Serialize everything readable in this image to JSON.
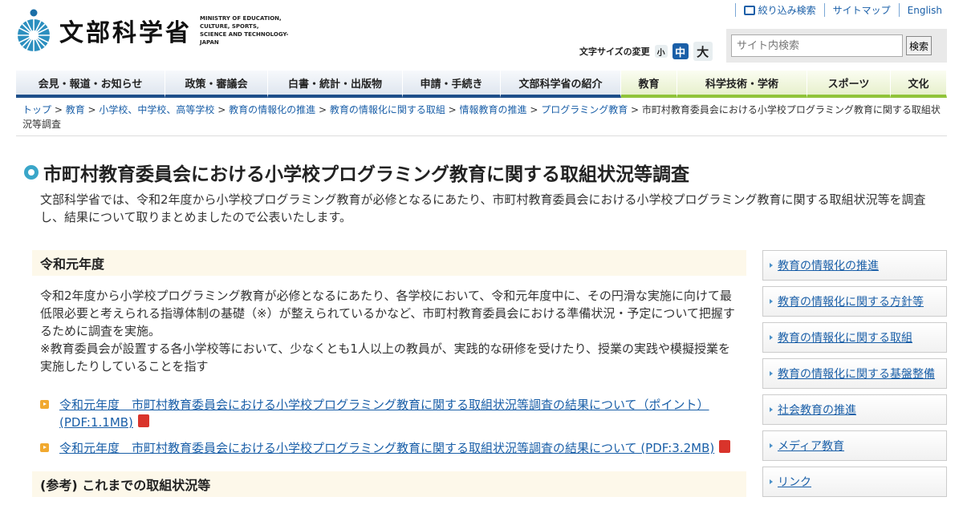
{
  "header": {
    "logo_jp": "文部科学省",
    "logo_en_lines": [
      "MINISTRY OF EDUCATION,",
      "CULTURE, SPORTS,",
      "SCIENCE AND TECHNOLOGY-JAPAN"
    ],
    "top_links": [
      "絞り込み検索",
      "サイトマップ",
      "English"
    ],
    "font_size_label": "文字サイズの変更",
    "font_sizes": [
      "小",
      "中",
      "大"
    ],
    "search_placeholder": "サイト内検索",
    "search_button": "検索"
  },
  "nav": {
    "items": [
      "会見・報道・お知らせ",
      "政策・審議会",
      "白書・統計・出版物",
      "申請・手続き",
      "文部科学省の紹介",
      "教育",
      "科学技術・学術",
      "スポーツ",
      "文化"
    ]
  },
  "breadcrumb": {
    "links": [
      "トップ",
      "教育",
      "小学校、中学校、高等学校",
      "教育の情報化の推進",
      "教育の情報化に関する取組",
      "情報教育の推進",
      "プログラミング教育"
    ],
    "current": "市町村教育委員会における小学校プログラミング教育に関する取組状況等調査"
  },
  "page": {
    "title": "市町村教育委員会における小学校プログラミング教育に関する取組状況等調査",
    "lead": "文部科学省では、令和2年度から小学校プログラミング教育が必修となるにあたり、市町村教育委員会における小学校プログラミング教育に関する取組状況等を調査し、結果について取りまとめましたので公表いたします。"
  },
  "section1": {
    "heading": "令和元年度",
    "para1": "令和2年度から小学校プログラミング教育が必修となるにあたり、各学校において、令和元年度中に、その円滑な実施に向けて最低限必要と考えられる指導体制の基礎（※）が整えられているかなど、市町村教育委員会における準備状況・予定について把握するために調査を実施。",
    "para2": "※教育委員会が設置する各小学校等において、少なくとも1人以上の教員が、実践的な研修を受けたり、授業の実践や模擬授業を実施したりしていることを指す",
    "links": [
      "令和元年度　市町村教育委員会における小学校プログラミング教育に関する取組状況等調査の結果について（ポイント） (PDF:1.1MB)",
      "令和元年度　市町村教育委員会における小学校プログラミング教育に関する取組状況等調査の結果について (PDF:3.2MB)"
    ]
  },
  "section2": {
    "heading": "(参考) これまでの取組状況等"
  },
  "side": {
    "items": [
      "教育の情報化の推進",
      "教育の情報化に関する方針等",
      "教育の情報化に関する取組",
      "教育の情報化に関する基盤整備",
      "社会教育の推進",
      "メディア教育",
      "リンク"
    ]
  }
}
